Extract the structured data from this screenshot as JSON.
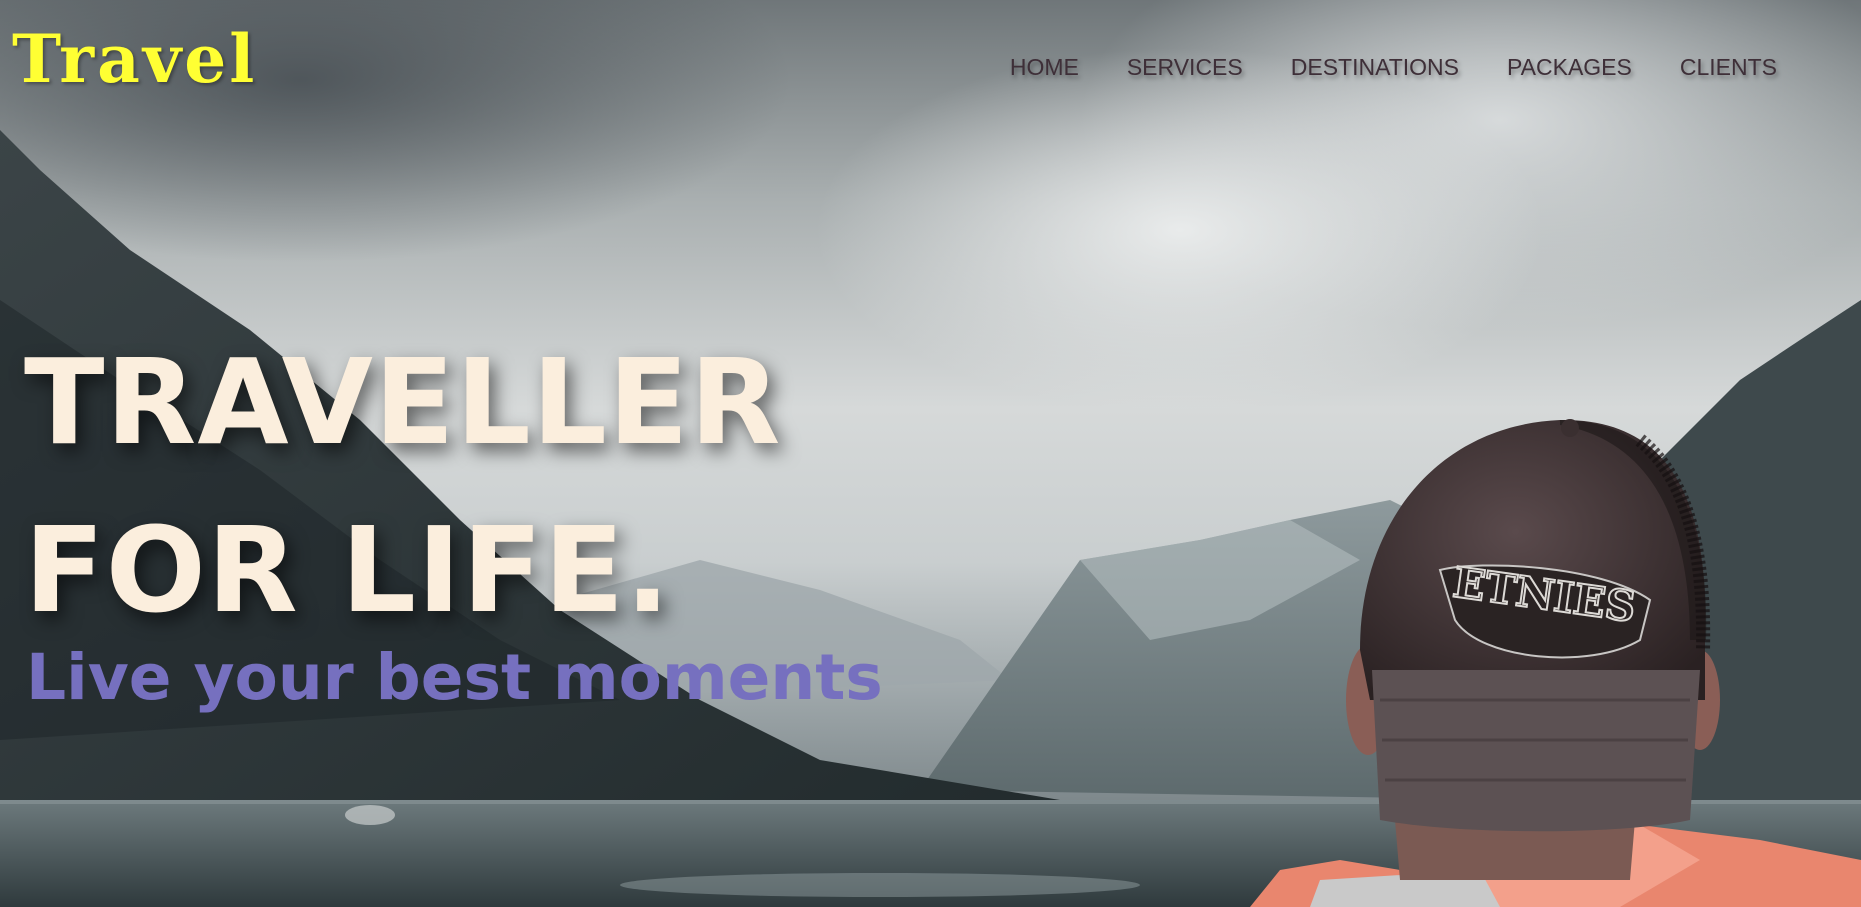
{
  "brand": {
    "logo_text": "Travel",
    "logo_color": "#ffff33"
  },
  "nav": {
    "items": [
      {
        "label": "HOME"
      },
      {
        "label": "SERVICES"
      },
      {
        "label": "DESTINATIONS"
      },
      {
        "label": "PACKAGES"
      },
      {
        "label": "CLIENTS"
      }
    ],
    "text_color": "#3e2f38"
  },
  "hero": {
    "title_line1": "TRAVELLER",
    "title_line2": "FOR LIFE.",
    "subtitle": "Live your best moments",
    "title_color": "#fbeedd",
    "subtitle_color": "#7670bf"
  },
  "background": {
    "description_icon": "mountain-lake-traveller-photo",
    "cap_text": "ETNIES"
  }
}
